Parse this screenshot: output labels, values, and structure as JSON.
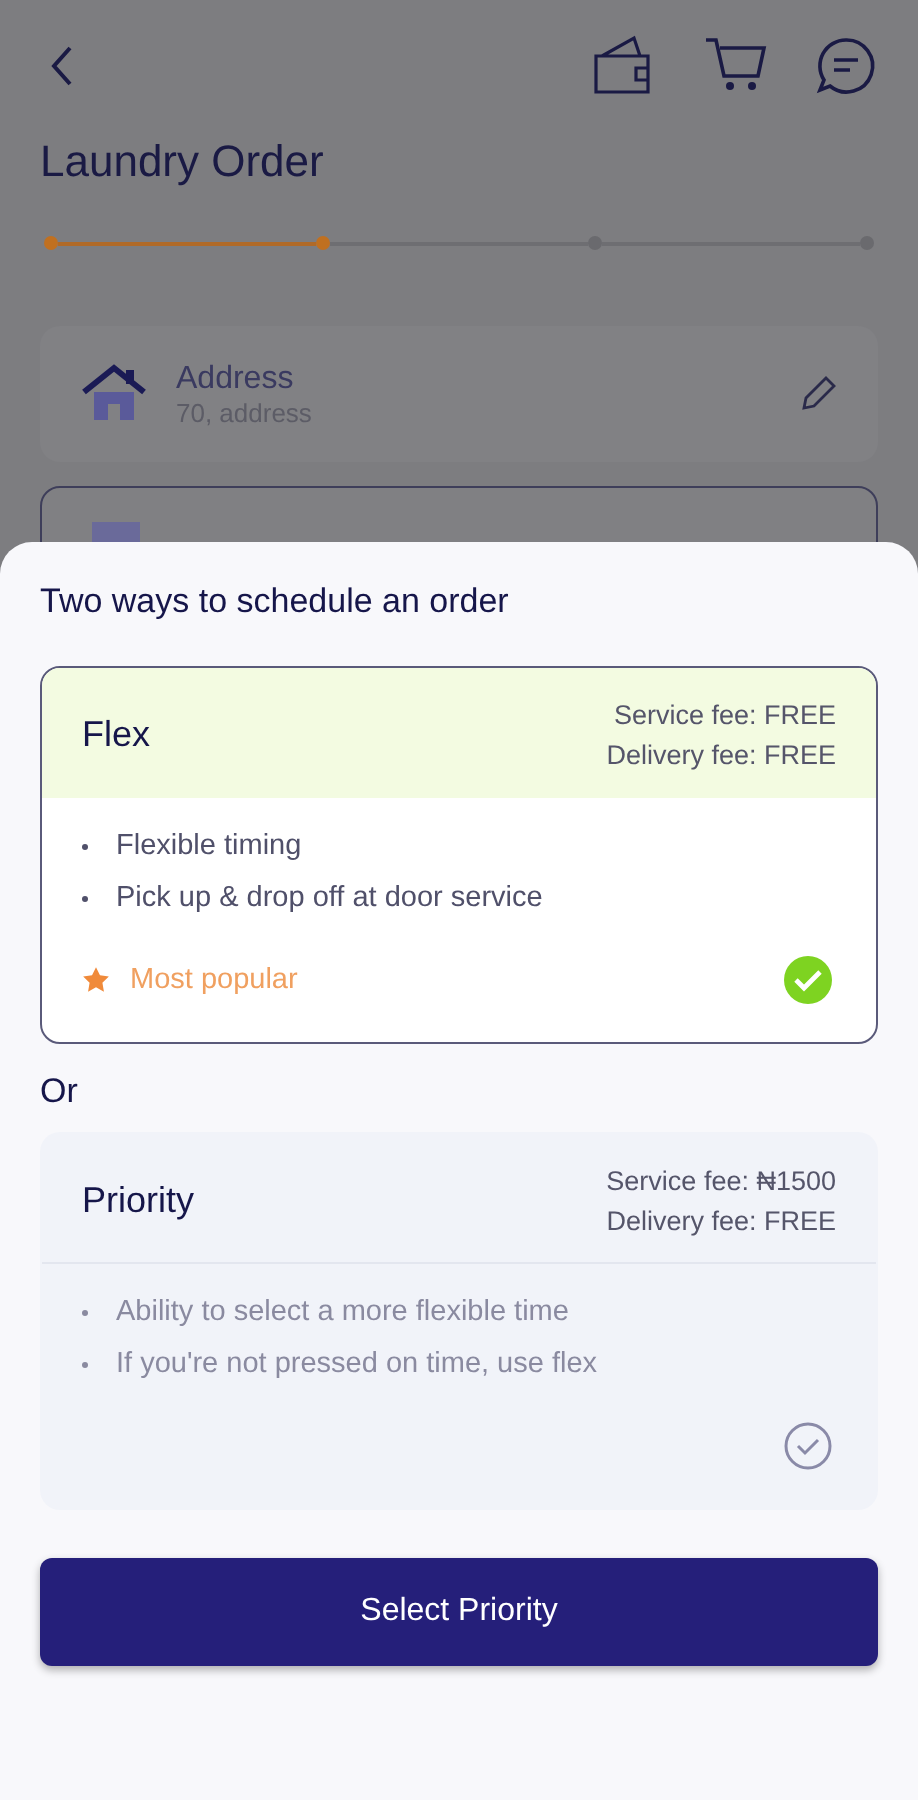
{
  "header": {
    "title": "Laundry Order"
  },
  "steps": [
    {
      "done": true
    },
    {
      "done": true
    },
    {
      "done": false
    },
    {
      "done": false
    }
  ],
  "address": {
    "label": "Address",
    "value": "70, address"
  },
  "sheet": {
    "title": "Two ways to schedule an order",
    "separator": "Or",
    "options": [
      {
        "name": "Flex",
        "selected": true,
        "fees": [
          "Service fee: FREE",
          "Delivery fee: FREE"
        ],
        "features": [
          "Flexible timing",
          "Pick up & drop off at door service"
        ],
        "badge": "Most popular"
      },
      {
        "name": "Priority",
        "selected": false,
        "fees": [
          "Service fee: ₦1500",
          "Delivery fee: FREE"
        ],
        "features": [
          "Ability to select a more flexible time",
          "If you're not pressed on time, use flex"
        ]
      }
    ],
    "button": "Select Priority"
  }
}
